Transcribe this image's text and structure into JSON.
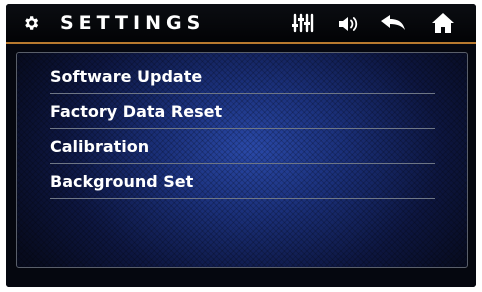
{
  "header": {
    "title": "SETTINGS",
    "icons": [
      "gear-icon",
      "equalizer-icon",
      "volume-icon",
      "back-icon",
      "home-icon"
    ],
    "accent_line_color": "#b8792f"
  },
  "menu": {
    "items": [
      {
        "label": "Software Update"
      },
      {
        "label": "Factory Data Reset"
      },
      {
        "label": "Calibration"
      },
      {
        "label": "Background Set"
      }
    ]
  }
}
